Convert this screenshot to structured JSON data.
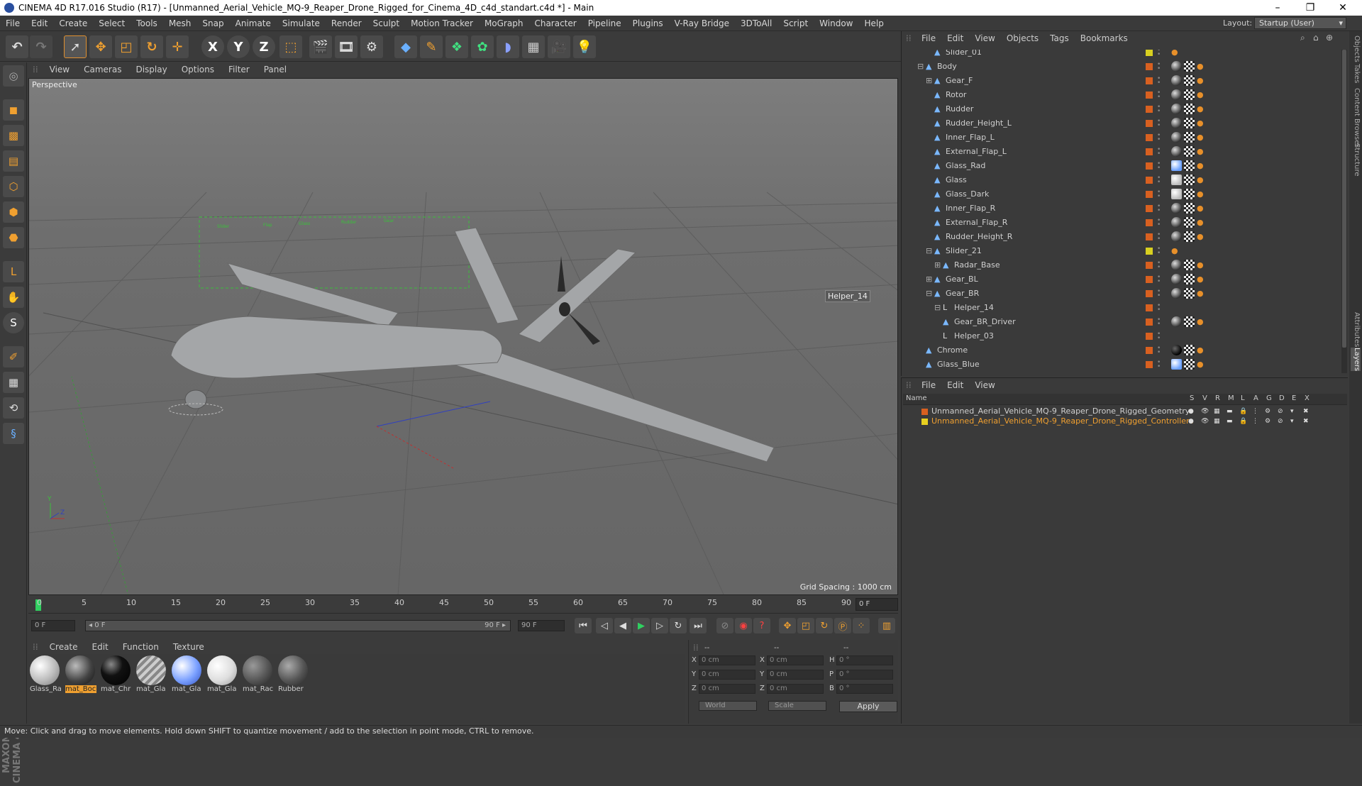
{
  "titlebar": {
    "title": "CINEMA 4D R17.016 Studio (R17) - [Unmanned_Aerial_Vehicle_MQ-9_Reaper_Drone_Rigged_for_Cinema_4D_c4d_standart.c4d *] - Main",
    "minimize": "–",
    "maximize": "❐",
    "close": "✕"
  },
  "menubar": {
    "items": [
      "File",
      "Edit",
      "Create",
      "Select",
      "Tools",
      "Mesh",
      "Snap",
      "Animate",
      "Simulate",
      "Render",
      "Sculpt",
      "Motion Tracker",
      "MoGraph",
      "Character",
      "Pipeline",
      "Plugins",
      "V-Ray Bridge",
      "3DToAll",
      "Script",
      "Window",
      "Help"
    ],
    "layout_label": "Layout:",
    "layout_value": "Startup (User)"
  },
  "viewport": {
    "menu": [
      "View",
      "Cameras",
      "Display",
      "Options",
      "Filter",
      "Panel"
    ],
    "view_name": "Perspective",
    "grid_spacing": "Grid Spacing : 1000 cm",
    "helper_label": "Helper_14"
  },
  "timeline": {
    "ticks": [
      "0",
      "5",
      "10",
      "15",
      "20",
      "25",
      "30",
      "35",
      "40",
      "45",
      "50",
      "55",
      "60",
      "65",
      "70",
      "75",
      "80",
      "85",
      "90"
    ],
    "current": "0 F"
  },
  "transport": {
    "start": "0 F",
    "range_start": "◂ 0 F",
    "range_end": "90 F ▸",
    "end": "90 F"
  },
  "materials": {
    "menu": [
      "Create",
      "Edit",
      "Function",
      "Texture"
    ],
    "items": [
      {
        "label": "Glass_Ra",
        "style": "glass"
      },
      {
        "label": "mat_Boc",
        "style": "dark",
        "selected": true
      },
      {
        "label": "mat_Chr",
        "style": "black"
      },
      {
        "label": "mat_Gla",
        "style": "stripe"
      },
      {
        "label": "mat_Gla",
        "style": "blue"
      },
      {
        "label": "mat_Gla",
        "style": "white"
      },
      {
        "label": "mat_Rac",
        "style": "grey"
      },
      {
        "label": "Rubber",
        "style": "rubber"
      }
    ]
  },
  "coords": {
    "head": [
      "--",
      "--",
      "--"
    ],
    "rows": [
      {
        "a": "X",
        "av": "0 cm",
        "b": "X",
        "bv": "0 cm",
        "c": "H",
        "cv": "0 °"
      },
      {
        "a": "Y",
        "av": "0 cm",
        "b": "Y",
        "bv": "0 cm",
        "c": "P",
        "cv": "0 °"
      },
      {
        "a": "Z",
        "av": "0 cm",
        "b": "Z",
        "bv": "0 cm",
        "c": "B",
        "cv": "0 °"
      }
    ],
    "world": "World",
    "scale": "Scale",
    "apply": "Apply"
  },
  "status": "Move: Click and drag to move elements. Hold down SHIFT to quantize movement / add to the selection in point mode, CTRL to remove.",
  "objects": {
    "menu": [
      "File",
      "Edit",
      "View",
      "Objects",
      "Tags",
      "Bookmarks"
    ],
    "rows": [
      {
        "name": "Slider_01",
        "indent": 2,
        "color": "#d8d020",
        "tags": "ik",
        "icon": "▲"
      },
      {
        "name": "Body",
        "indent": 1,
        "color": "#d86020",
        "tags": "sph",
        "icon": "▲",
        "exp": "⊟"
      },
      {
        "name": "Gear_F",
        "indent": 2,
        "color": "#d86020",
        "tags": "full",
        "icon": "▲",
        "exp": "⊞"
      },
      {
        "name": "Rotor",
        "indent": 2,
        "color": "#d86020",
        "tags": "full",
        "icon": "▲"
      },
      {
        "name": "Rudder",
        "indent": 2,
        "color": "#d86020",
        "tags": "full",
        "icon": "▲"
      },
      {
        "name": "Rudder_Height_L",
        "indent": 2,
        "color": "#d86020",
        "tags": "full",
        "icon": "▲"
      },
      {
        "name": "Inner_Flap_L",
        "indent": 2,
        "color": "#d86020",
        "tags": "full",
        "icon": "▲"
      },
      {
        "name": "External_Flap_L",
        "indent": 2,
        "color": "#d86020",
        "tags": "full",
        "icon": "▲"
      },
      {
        "name": "Glass_Rad",
        "indent": 2,
        "color": "#d86020",
        "tags": "blue",
        "icon": "▲"
      },
      {
        "name": "Glass",
        "indent": 2,
        "color": "#d86020",
        "tags": "wht",
        "icon": "▲"
      },
      {
        "name": "Glass_Dark",
        "indent": 2,
        "color": "#d86020",
        "tags": "wht",
        "icon": "▲"
      },
      {
        "name": "Inner_Flap_R",
        "indent": 2,
        "color": "#d86020",
        "tags": "full",
        "icon": "▲"
      },
      {
        "name": "External_Flap_R",
        "indent": 2,
        "color": "#d86020",
        "tags": "full",
        "icon": "▲"
      },
      {
        "name": "Rudder_Height_R",
        "indent": 2,
        "color": "#d86020",
        "tags": "full",
        "icon": "▲"
      },
      {
        "name": "Slider_21",
        "indent": 2,
        "color": "#d8d020",
        "tags": "ik",
        "icon": "▲",
        "exp": "⊟"
      },
      {
        "name": "Radar_Base",
        "indent": 3,
        "color": "#d86020",
        "tags": "full",
        "icon": "▲",
        "exp": "⊞"
      },
      {
        "name": "Gear_BL",
        "indent": 2,
        "color": "#d86020",
        "tags": "full",
        "icon": "▲",
        "exp": "⊞"
      },
      {
        "name": "Gear_BR",
        "indent": 2,
        "color": "#d86020",
        "tags": "full",
        "icon": "▲",
        "exp": "⊟"
      },
      {
        "name": "Helper_14",
        "indent": 3,
        "color": "#d86020",
        "tags": "none",
        "icon": "L",
        "exp": "⊟"
      },
      {
        "name": "Gear_BR_Driver",
        "indent": 3,
        "color": "#d86020",
        "tags": "sph",
        "icon": "▲"
      },
      {
        "name": "Helper_03",
        "indent": 3,
        "color": "#d86020",
        "tags": "none",
        "icon": "L"
      },
      {
        "name": "Chrome",
        "indent": 1,
        "color": "#d86020",
        "tags": "blk",
        "icon": "▲"
      },
      {
        "name": "Glass_Blue",
        "indent": 1,
        "color": "#d86020",
        "tags": "blue",
        "icon": "▲"
      }
    ]
  },
  "layers": {
    "menu": [
      "File",
      "Edit",
      "View"
    ],
    "head": {
      "name": "Name",
      "cols": [
        "S",
        "V",
        "R",
        "M",
        "L",
        "A",
        "G",
        "D",
        "E",
        "X"
      ]
    },
    "rows": [
      {
        "name": "Unmanned_Aerial_Vehicle_MQ-9_Reaper_Drone_Rigged_Geometry",
        "color": "#d86020",
        "text_color": "#d0d0d0"
      },
      {
        "name": "Unmanned_Aerial_Vehicle_MQ-9_Reaper_Drone_Rigged_Controllers",
        "color": "#e8d020",
        "text_color": "#f0a030"
      }
    ]
  },
  "sidetabs": [
    "Objects",
    "Takes",
    "Content Browser",
    "Structure",
    "Attributes",
    "Layers"
  ]
}
